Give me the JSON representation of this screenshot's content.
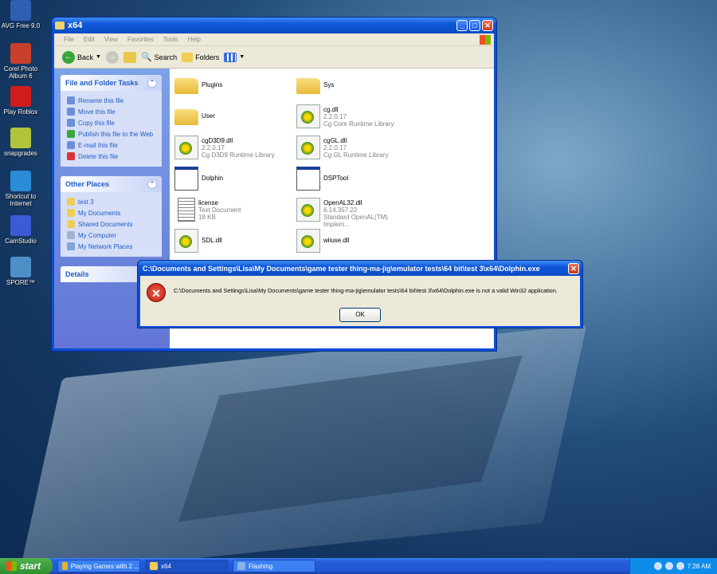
{
  "desktop": {
    "icons": [
      {
        "label": "AVG Free 9.0",
        "icon": "avg-icon",
        "color": "#2f5fb3"
      },
      {
        "label": "Corel Photo Album 6",
        "icon": "corel-icon",
        "color": "#c8402b"
      },
      {
        "label": "Play Roblox",
        "icon": "roblox-icon",
        "color": "#d11c1c"
      },
      {
        "label": "snapgrades",
        "icon": "snapgrades-icon",
        "color": "#b2c43a"
      },
      {
        "label": "Shortcut to Internet",
        "icon": "internet-explorer-icon",
        "color": "#2a8bd6"
      },
      {
        "label": "CamStudio",
        "icon": "camstudio-icon",
        "color": "#3b5bd6"
      },
      {
        "label": "SPORE™",
        "icon": "spore-icon",
        "color": "#4f8fc8"
      }
    ]
  },
  "explorer": {
    "title": "x64",
    "menu": [
      "File",
      "Edit",
      "View",
      "Favorites",
      "Tools",
      "Help"
    ],
    "toolbar": {
      "back": "Back",
      "search": "Search",
      "folders": "Folders"
    },
    "tasks_panel": {
      "title": "File and Folder Tasks",
      "items": [
        "Rename this file",
        "Move this file",
        "Copy this file",
        "Publish this file to the Web",
        "E-mail this file",
        "Delete this file"
      ]
    },
    "places_panel": {
      "title": "Other Places",
      "items": [
        "test 3",
        "My Documents",
        "Shared Documents",
        "My Computer",
        "My Network Places"
      ]
    },
    "details_panel": {
      "title": "Details"
    },
    "files": [
      {
        "name": "Plugins",
        "type": "folder",
        "l2": "",
        "l3": ""
      },
      {
        "name": "Sys",
        "type": "folder",
        "l2": "",
        "l3": ""
      },
      {
        "name": "User",
        "type": "folder",
        "l2": "",
        "l3": ""
      },
      {
        "name": "cg.dll",
        "type": "dll",
        "l2": "2.2.0.17",
        "l3": "Cg Core Runtime Library"
      },
      {
        "name": "cgD3D9.dll",
        "type": "dll",
        "l2": "2.2.0.17",
        "l3": "Cg D3D9 Runtime Library"
      },
      {
        "name": "cgGL.dll",
        "type": "dll",
        "l2": "2.2.0.17",
        "l3": "Cg GL Runtime Library"
      },
      {
        "name": "Dolphin",
        "type": "exe",
        "l2": "",
        "l3": ""
      },
      {
        "name": "DSPTool",
        "type": "exe",
        "l2": "",
        "l3": ""
      },
      {
        "name": "license",
        "type": "txt",
        "l2": "Text Document",
        "l3": "18 KB"
      },
      {
        "name": "OpenAL32.dll",
        "type": "dll",
        "l2": "6.14.357.22",
        "l3": "Standard OpenAL(TM) Implem..."
      },
      {
        "name": "SDL.dll",
        "type": "dll",
        "l2": "",
        "l3": ""
      },
      {
        "name": "wiiuse.dll",
        "type": "dll",
        "l2": "",
        "l3": ""
      }
    ]
  },
  "dialog": {
    "title": "C:\\Documents and Settings\\Lisa\\My Documents\\game tester thing-ma-jig\\emulator tests\\64 bit\\test 3\\x64\\Dolphin.exe",
    "message": "C:\\Documents and Settings\\Lisa\\My Documents\\game tester thing-ma-jig\\emulator tests\\64 bit\\test 3\\x64\\Dolphin.exe is not a valid Win32 application.",
    "ok": "OK"
  },
  "taskbar": {
    "start": "start",
    "tasks": [
      {
        "label": "Playing Games with 2 ...",
        "icon": "chrome-icon"
      },
      {
        "label": "x64",
        "icon": "folder-icon"
      },
      {
        "label": "Flashing",
        "icon": "app-icon"
      }
    ],
    "clock": "7:28 AM"
  }
}
